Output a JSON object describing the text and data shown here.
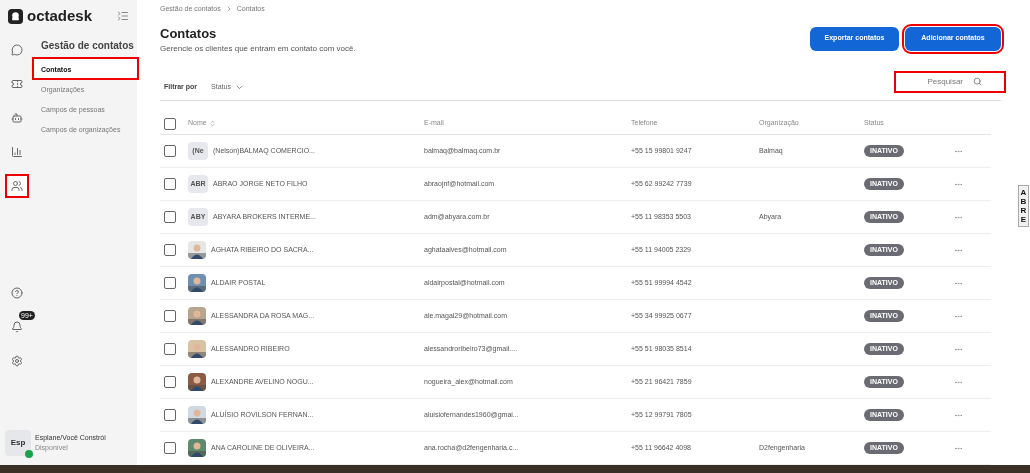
{
  "brand": {
    "name": "octadesk"
  },
  "rail": [
    {
      "kind": "chat",
      "selected": false
    },
    {
      "kind": "ticket",
      "selected": false
    },
    {
      "kind": "bot",
      "selected": false
    },
    {
      "kind": "report",
      "selected": false
    },
    {
      "kind": "contacts",
      "selected": true
    }
  ],
  "rail_bottom": [
    {
      "kind": "help"
    },
    {
      "kind": "bell",
      "badge": "99+"
    },
    {
      "kind": "gear"
    }
  ],
  "sidebar": {
    "title": "Gestão de contatos",
    "items": [
      {
        "label": "Contatos",
        "selected": true
      },
      {
        "label": "Organizações",
        "selected": false
      },
      {
        "label": "Campos de pessoas",
        "selected": false
      },
      {
        "label": "Campos de organizações",
        "selected": false
      }
    ]
  },
  "user": {
    "initials": "Esp",
    "name": "Esplane/Você Constrói",
    "status": "Disponível",
    "online": true
  },
  "breadcrumb": [
    "Gestão de contatos",
    "Contatos"
  ],
  "page": {
    "title": "Contatos",
    "subtitle": "Gerencie os clientes que entram em contato com você."
  },
  "buttons": [
    "Exportar contatos",
    "Adicionar contatos"
  ],
  "filter": {
    "label": "Filtrar por",
    "value": "Status"
  },
  "search": {
    "placeholder": "Pesquisar"
  },
  "table": {
    "all_checked": false,
    "columns": [
      "Nome",
      "E-mail",
      "Telefone",
      "Organização",
      "Status"
    ],
    "rows": [
      {
        "avatar": {
          "kind": "initials",
          "text": "(Ne"
        },
        "name": "(Nelson)BALMAQ COMERCIO...",
        "email": "balmaq@balmaq.com.br",
        "phone": "+55 15 99801 9247",
        "org": "Balmaq",
        "status": "INATIVO",
        "checked": false
      },
      {
        "avatar": {
          "kind": "initials",
          "text": "ABR"
        },
        "name": "ABRAO JORGE NETO FILHO",
        "email": "abraojnf@hotmail.com",
        "phone": "+55 62 99242 7739",
        "org": "",
        "status": "INATIVO",
        "checked": false
      },
      {
        "avatar": {
          "kind": "initials",
          "text": "ABY"
        },
        "name": "ABYARA BROKERS INTERME...",
        "email": "adm@abyara.com.br",
        "phone": "+55 11 98353 5503",
        "org": "Abyara",
        "status": "INATIVO",
        "checked": false
      },
      {
        "name": "AGHATA RIBEIRO DO SACRA...",
        "email": "aghataalves@hotmail.com",
        "phone": "+55 11 94005 2329",
        "org": "",
        "status": "INATIVO",
        "checked": false
      },
      {
        "name": "ALDAIR POSTAL",
        "email": "aldairpostal@hotmail.com",
        "phone": "+55 51 99994 4542",
        "org": "",
        "status": "INATIVO",
        "checked": false
      },
      {
        "name": "ALESSANDRA DA ROSA MAG...",
        "email": "ale.magal29@hotmail.com",
        "phone": "+55 34 99925 0677",
        "org": "",
        "status": "INATIVO",
        "checked": false
      },
      {
        "name": "ALESSANDRO RIBEIRO",
        "email": "alessandroribeiro73@gmail....",
        "phone": "+55 51 98035 8514",
        "org": "",
        "status": "INATIVO",
        "checked": false
      },
      {
        "name": "ALEXANDRE AVELINO NOGU...",
        "email": "nogueira_alex@hotmail.com",
        "phone": "+55 21 96421 7859",
        "org": "",
        "status": "INATIVO",
        "checked": false
      },
      {
        "name": "ALUÍSIO ROVILSON FERNAN...",
        "email": "aluisiofernandes1960@gmai...",
        "phone": "+55 12 99791 7805",
        "org": "",
        "status": "INATIVO",
        "checked": false
      },
      {
        "name": "ANA CAROLINE DE OLIVEIRA...",
        "email": "ana.rocha@d2fengenharia.c...",
        "phone": "+55 11 96642 4098",
        "org": "D2fengenharia",
        "status": "INATIVO",
        "checked": false
      }
    ]
  },
  "side_tab": {
    "letters": [
      "A",
      "B",
      "R",
      "E"
    ]
  }
}
